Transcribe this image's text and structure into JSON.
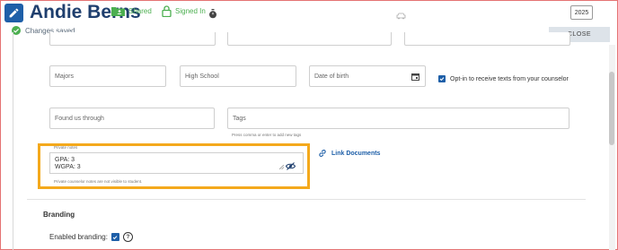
{
  "header": {
    "title": "Andie Berns",
    "shared_label": "Shared",
    "signed_in_label": "Signed In",
    "year": "2025"
  },
  "status": {
    "changes_saved": "Changes saved"
  },
  "close_label": "CLOSE",
  "form": {
    "majors_placeholder": "Majors",
    "high_school_placeholder": "High School",
    "dob_placeholder": "Date of birth",
    "opt_in_label": "Opt-in to receive texts from your counselor",
    "found_us_placeholder": "Found us through",
    "tags_placeholder": "Tags",
    "tags_hint": "Press comma or enter to add new tags"
  },
  "private_notes": {
    "label": "Private notes",
    "line1": "GPA: 3",
    "line2": "WGPA: 3",
    "hint": "Private counselor notes are not visible to student."
  },
  "link_documents": "Link Documents",
  "branding": {
    "heading": "Branding",
    "enabled_label": "Enabled branding:"
  },
  "colors": {
    "accent": "#1e5fa8",
    "success": "#4caf50",
    "highlight": "#f4a91c"
  }
}
